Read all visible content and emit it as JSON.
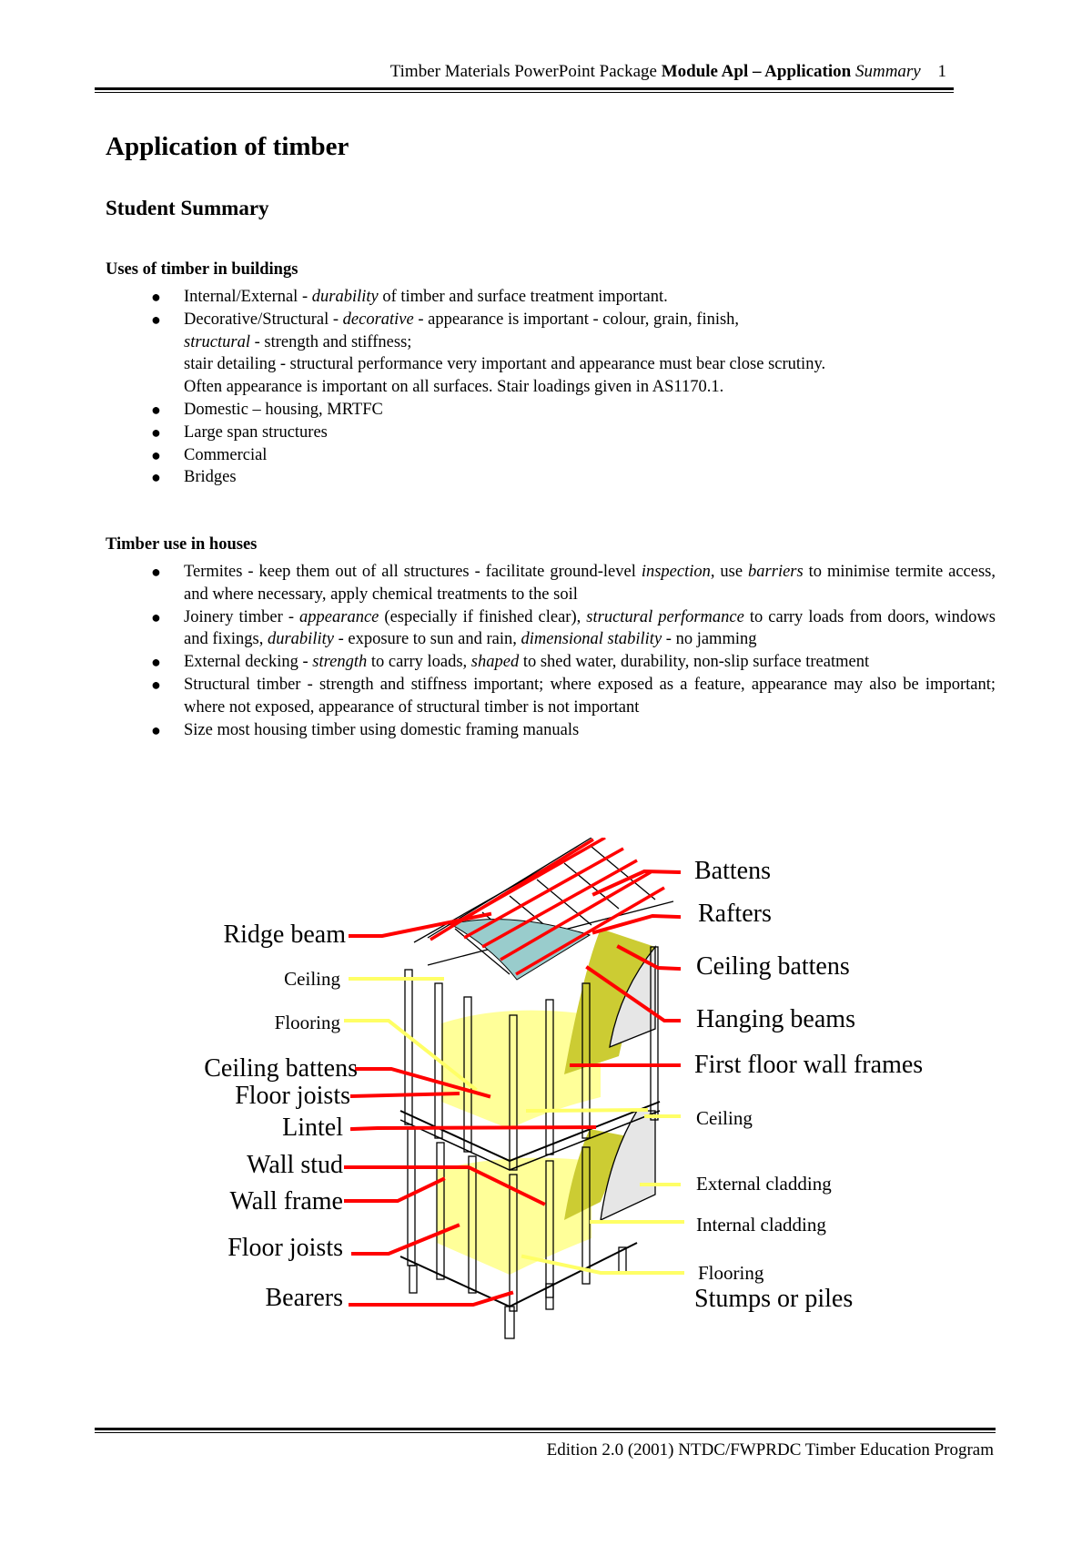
{
  "header": {
    "prefix": "Timber Materials PowerPoint Package",
    "module": "Module Apl – Application",
    "suffix": "Summary",
    "page_number": "1"
  },
  "title": "Application of timber",
  "subtitle": "Student Summary",
  "section1": {
    "heading": "Uses of timber in buildings",
    "items": [
      {
        "lead": "Internal/External  - ",
        "em": "durability",
        "rest": " of timber and surface treatment important."
      },
      {
        "lead": "Decorative/Structural - ",
        "em": "decorative",
        "rest": " - appearance is important - colour, grain, finish,",
        "line2_em": "structural",
        "line2_rest": " - strength and stiffness;",
        "line3": "stair detailing - structural performance very important and appearance must bear close scrutiny.",
        "line4": "Often appearance is important on all surfaces.  Stair loadings given in AS1170.1."
      },
      {
        "text": "Domestic – housing, MRTFC"
      },
      {
        "text": "Large span structures"
      },
      {
        "text": "Commercial"
      },
      {
        "text": "Bridges"
      }
    ]
  },
  "section2": {
    "heading": "Timber use in houses",
    "items": [
      {
        "a": "Termites - keep them out of all structures - facilitate ground-level ",
        "b_em": "inspection",
        "c": ", use ",
        "d_em": "barriers",
        "e": " to minimise termite access, and where necessary, apply chemical treatments to the soil"
      },
      {
        "a": "Joinery timber - ",
        "b_em": "appearance",
        "c": " (especially if finished clear), ",
        "d_em": "structural performance",
        "e": " to carry loads from doors, windows and fixings, ",
        "f_em": "durability",
        "g": " - exposure to sun and rain, ",
        "h_em": "dimensional stability",
        "i": " - no jamming"
      },
      {
        "a": "External decking - ",
        "b_em": "strength",
        "c": " to carry loads, ",
        "d_em": "shaped",
        "e": " to shed water, durability, non-slip surface treatment"
      },
      {
        "a": "Structural timber - strength and stiffness important; where exposed as a feature, appearance may also be important; where not exposed, appearance of structural timber is not important"
      },
      {
        "a": "Size most housing timber using domestic framing manuals"
      }
    ]
  },
  "diagram": {
    "colors": {
      "leader_red": "#ff0000",
      "leader_yellow": "#ffff66",
      "ceiling_panel": "#99cccc",
      "insulation": "#cccc33",
      "floor_fill": "#ffff99",
      "cladding": "#e6e6e6"
    },
    "labels_left": {
      "ridge_beam": "Ridge beam",
      "ceiling": "Ceiling",
      "flooring": "Flooring",
      "ceiling_battens": "Ceiling battens",
      "floor_joists_upper": "Floor joists",
      "lintel": "Lintel",
      "wall_stud": "Wall stud",
      "wall_frame": "Wall frame",
      "floor_joists_lower": "Floor joists",
      "bearers": "Bearers"
    },
    "labels_right": {
      "battens": "Battens",
      "rafters": "Rafters",
      "ceiling_battens": "Ceiling battens",
      "hanging_beams": "Hanging beams",
      "first_floor_wall_frames": "First floor wall frames",
      "ceiling": "Ceiling",
      "external_cladding": "External cladding",
      "internal_cladding": "Internal cladding",
      "flooring": "Flooring",
      "stumps_or_piles": "Stumps or piles"
    }
  },
  "footer": {
    "text": "Edition 2.0 (2001)  NTDC/FWPRDC Timber Education Program"
  }
}
